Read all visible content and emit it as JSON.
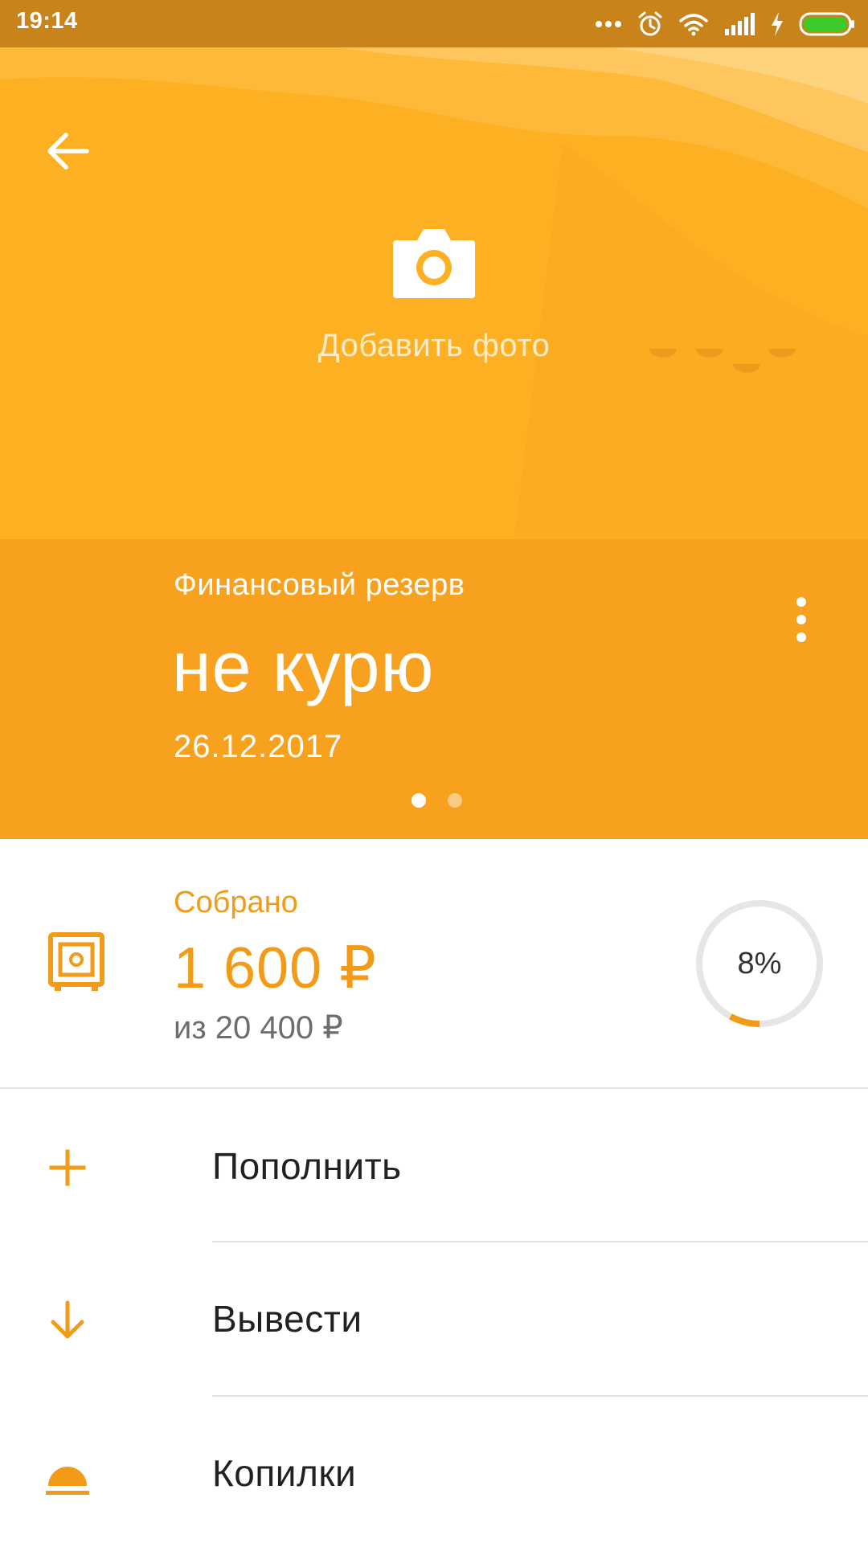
{
  "status_bar": {
    "time": "19:14",
    "icons": [
      "more-dots-icon",
      "alarm-icon",
      "wifi-icon",
      "signal-icon",
      "charging-icon",
      "battery-icon"
    ]
  },
  "header": {
    "back_icon": "arrow-left-icon",
    "camera_icon": "camera-icon",
    "add_photo_label": "Добавить фото"
  },
  "goal": {
    "type": "Финансовый резерв",
    "name": "не курю",
    "date": "26.12.2017",
    "pager": {
      "count": 2,
      "active": 0
    }
  },
  "collected": {
    "label": "Собрано",
    "amount": "1 600 ₽",
    "target": "из 20 400 ₽",
    "percent_label": "8%",
    "progress": 0.08
  },
  "actions": [
    {
      "label": "Пополнить",
      "icon": "plus-icon"
    },
    {
      "label": "Вывести",
      "icon": "arrow-down-icon"
    },
    {
      "label": "Копилки",
      "icon": "piggy-bank-icon"
    }
  ],
  "colors": {
    "status_bar": "#C8841A",
    "hero": "#FDB022",
    "title_band": "#F7A11E",
    "accent": "#F29B18",
    "text_dark": "#212121",
    "text_muted": "#6d6d6d"
  }
}
